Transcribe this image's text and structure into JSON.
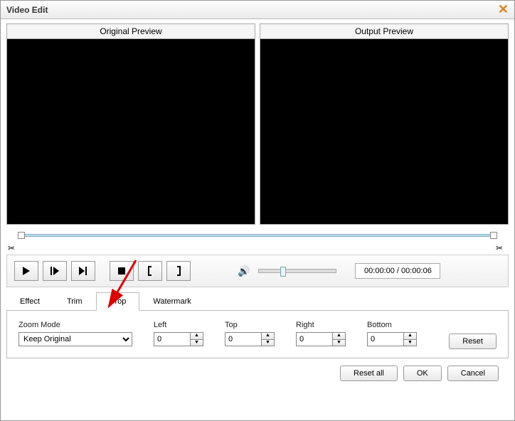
{
  "title": "Video Edit",
  "previews": {
    "original": "Original Preview",
    "output": "Output Preview"
  },
  "playback": {
    "time_display": "00:00:00 / 00:00:06"
  },
  "tabs": {
    "effect": "Effect",
    "trim": "Trim",
    "crop": "Crop",
    "watermark": "Watermark",
    "active": "crop"
  },
  "crop": {
    "zoom_mode_label": "Zoom Mode",
    "zoom_mode_value": "Keep Original",
    "left_label": "Left",
    "left_value": "0",
    "top_label": "Top",
    "top_value": "0",
    "right_label": "Right",
    "right_value": "0",
    "bottom_label": "Bottom",
    "bottom_value": "0",
    "reset_label": "Reset"
  },
  "buttons": {
    "reset_all": "Reset all",
    "ok": "OK",
    "cancel": "Cancel"
  }
}
